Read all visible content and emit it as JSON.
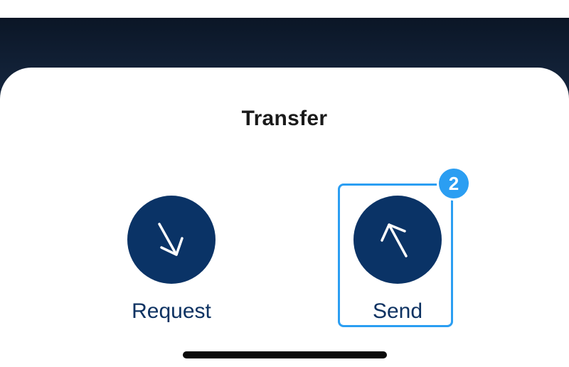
{
  "sheet": {
    "title": "Transfer"
  },
  "actions": [
    {
      "label": "Request",
      "icon": "arrow-down-right-icon"
    },
    {
      "label": "Send",
      "icon": "arrow-up-left-icon"
    }
  ],
  "annotation": {
    "step": "2",
    "color": "#2b9ef2"
  },
  "colors": {
    "action_circle": "#0a3366",
    "action_label": "#0d3262",
    "backdrop": "#13233a"
  }
}
